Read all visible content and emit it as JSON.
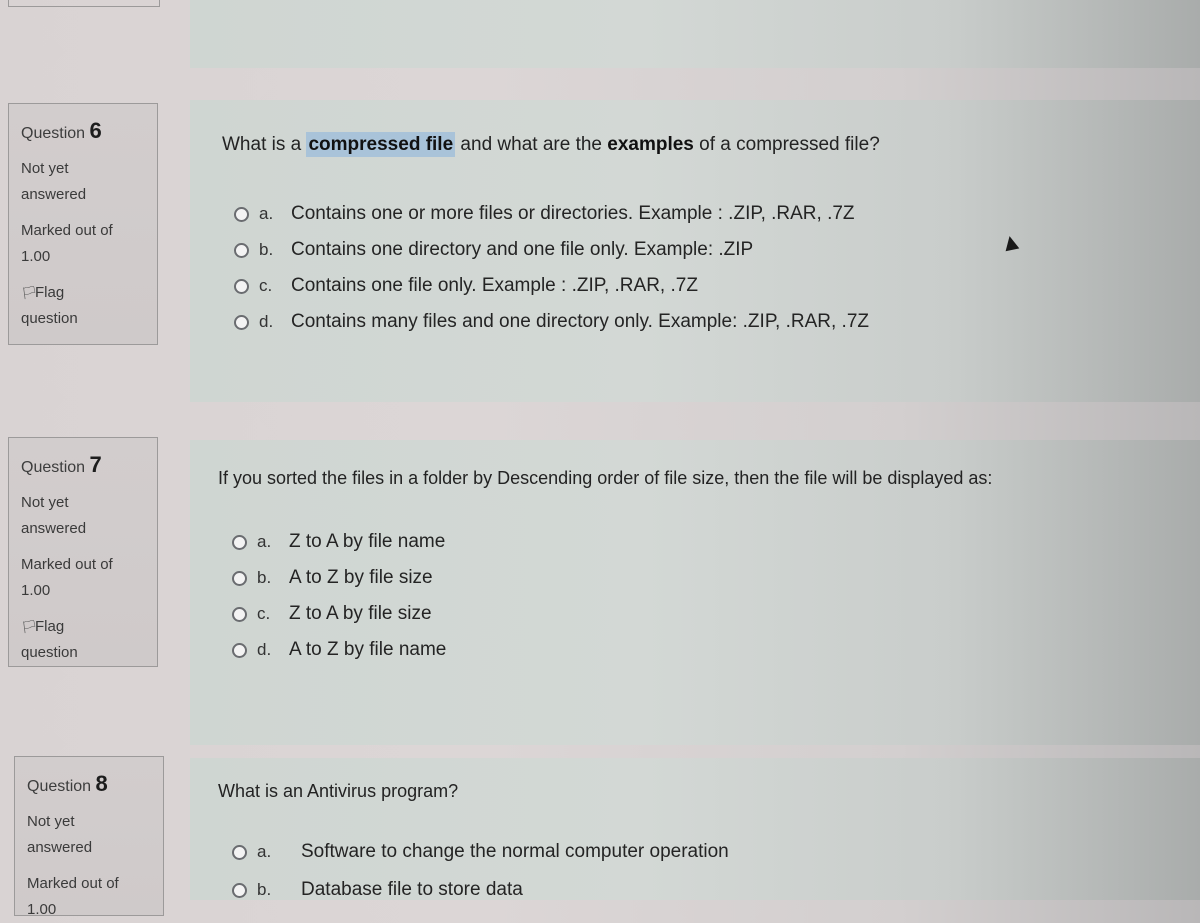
{
  "questions": [
    {
      "label": "Question",
      "number": "6",
      "status": "Not yet answered",
      "status_line1": "Not yet",
      "status_line2": "answered",
      "marked_label": "Marked out of",
      "marked_value": "1.00",
      "flag_line1": "Flag",
      "flag_line2": "question",
      "text_parts": {
        "p1": "What is a ",
        "highlight": "compressed file",
        "p2": " and what are the ",
        "bold": "examples",
        "p3": " of a compressed file?"
      },
      "options": [
        {
          "letter": "a.",
          "text": "Contains one or more files or directories. Example : .ZIP, .RAR, .7Z",
          "selected": false
        },
        {
          "letter": "b.",
          "text": "Contains one directory and one file only. Example: .ZIP",
          "selected": false
        },
        {
          "letter": "c.",
          "text": "Contains one file only. Example : .ZIP, .RAR, .7Z",
          "selected": false
        },
        {
          "letter": "d.",
          "text": "Contains many files and one directory only. Example: .ZIP, .RAR, .7Z",
          "selected": false
        }
      ]
    },
    {
      "label": "Question",
      "number": "7",
      "status_line1": "Not yet",
      "status_line2": "answered",
      "marked_label": "Marked out of",
      "marked_value": "1.00",
      "flag_line1": "Flag",
      "flag_line2": "question",
      "text": "If you sorted the files in a folder by Descending order of file size, then the file will be displayed as:",
      "options": [
        {
          "letter": "a.",
          "text": "Z to A by file name",
          "selected": false
        },
        {
          "letter": "b.",
          "text": "A to Z by file size",
          "selected": false
        },
        {
          "letter": "c.",
          "text": "Z to A by file size",
          "selected": false
        },
        {
          "letter": "d.",
          "text": "A to Z by file name",
          "selected": false
        }
      ]
    },
    {
      "label": "Question",
      "number": "8",
      "status_line1": "Not yet",
      "status_line2": "answered",
      "marked_label": "Marked out of",
      "marked_value": "1.00",
      "text": "What is an Antivirus program?",
      "options": [
        {
          "letter": "a.",
          "text": "Software to change the normal computer operation",
          "selected": false
        },
        {
          "letter": "b.",
          "text": "Database file to store data",
          "selected": false
        }
      ]
    }
  ],
  "icons": {
    "flag": "flag-icon",
    "radio": "radio-unchecked-icon",
    "cursor": "mouse-pointer-icon"
  },
  "colors": {
    "highlight": "#a9c3d9",
    "content_bg": "#d3d8d5",
    "info_bg": "#d2cdcd"
  }
}
